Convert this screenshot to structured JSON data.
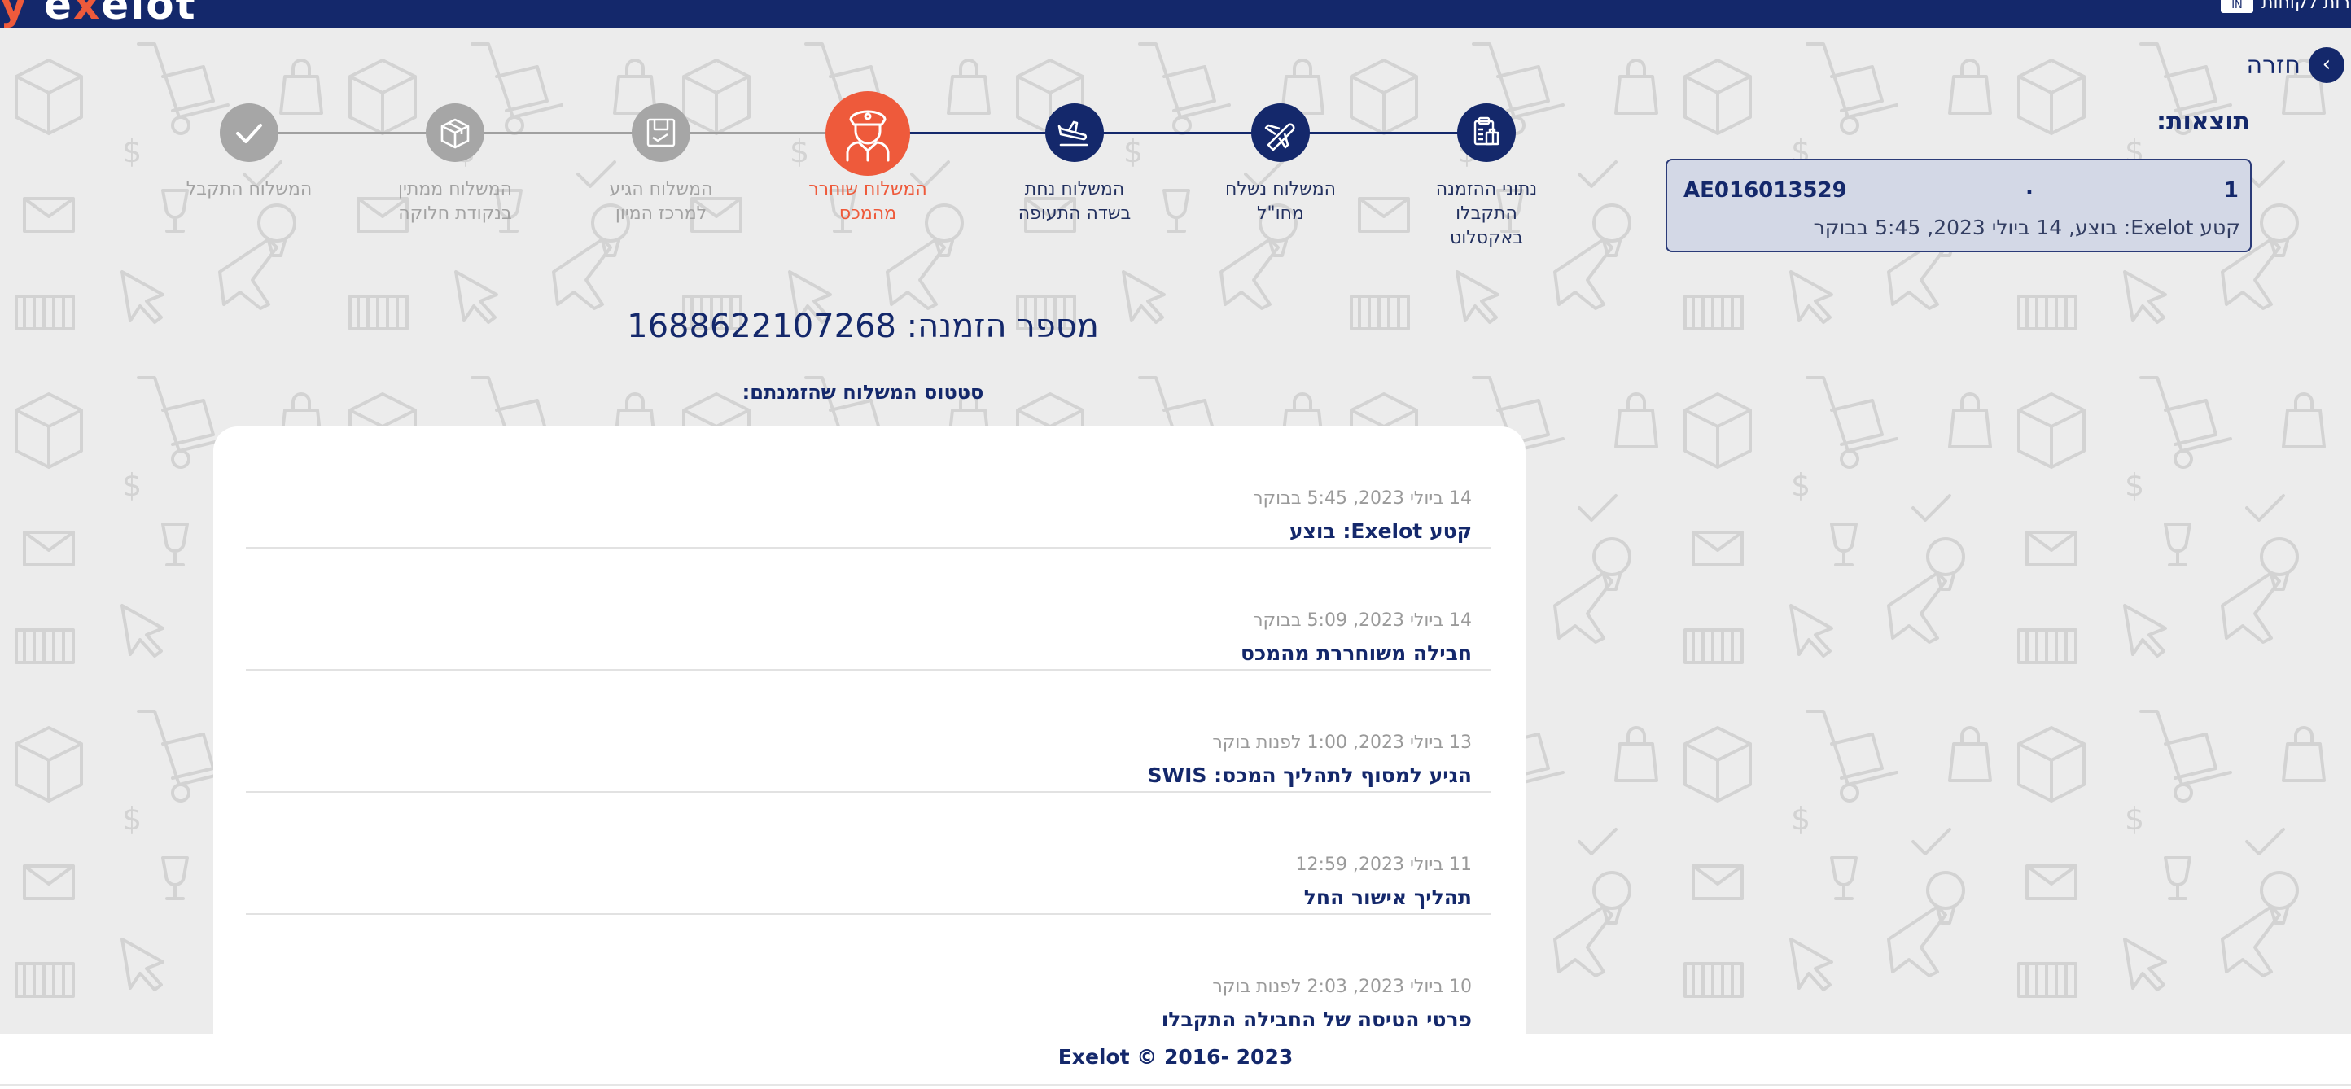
{
  "header": {
    "logo_prefix": "y",
    "logo_main_1": "e",
    "logo_accent": "x",
    "logo_main_2": "elot",
    "lang_code": "IN",
    "top_link": "שירות לקוחות",
    "colors": {
      "navy": "#14286b",
      "accent": "#ee5a3b"
    }
  },
  "back": {
    "label": "חזרה",
    "icon": "chevron-right-icon"
  },
  "results": {
    "title": "תוצאות:",
    "items": [
      {
        "index": "1",
        "separator": ".",
        "tracking_number": "AE016013529",
        "status": "קטע Exelot: בוצע, 14 ביולי 2023, 5:45 בבוקר"
      }
    ]
  },
  "stepper": {
    "steps": [
      {
        "label_line1": "נתוני ההזמנה",
        "label_line2": "התקבלו",
        "label_line3": "באקסלוט",
        "state": "done",
        "icon": "clipboard-icon"
      },
      {
        "label_line1": "המשלוח נשלח",
        "label_line2": "מחו\"ל",
        "label_line3": "",
        "state": "done",
        "icon": "airplane-takeoff-icon"
      },
      {
        "label_line1": "המשלוח נחת",
        "label_line2": "בשדה התעופה",
        "label_line3": "",
        "state": "done",
        "icon": "airplane-landing-icon"
      },
      {
        "label_line1": "המשלוח שוחרר",
        "label_line2": "מהמכס",
        "label_line3": "",
        "state": "current",
        "icon": "customs-officer-icon"
      },
      {
        "label_line1": "המשלוח הגיע",
        "label_line2": "למרכז המיון",
        "label_line3": "",
        "state": "future",
        "icon": "sorting-center-icon"
      },
      {
        "label_line1": "המשלוח ממתין",
        "label_line2": "בנקודת חלוקה",
        "label_line3": "",
        "state": "future",
        "icon": "package-icon"
      },
      {
        "label_line1": "המשלוח התקבל",
        "label_line2": "",
        "label_line3": "",
        "state": "future",
        "icon": "checkmark-icon"
      }
    ]
  },
  "order": {
    "title": "מספר הזמנה: 1688622107268",
    "status_subtitle": "סטטוס המשלוח שהזמנתם:"
  },
  "events": [
    {
      "date": "14 ביולי 2023, 5:45 בבוקר",
      "text": "קטע Exelot: בוצע"
    },
    {
      "date": "14 ביולי 2023, 5:09 בבוקר",
      "text": "חבילה משוחררת מהמכס"
    },
    {
      "date": "13 ביולי 2023, 1:00 לפנות בוקר",
      "text": "הגיע למסוף לתהליך המכס: SWIS"
    },
    {
      "date": "11 ביולי 2023, 12:59",
      "text": "תהליך אישור החל"
    },
    {
      "date": "10 ביולי 2023, 2:03 לפנות בוקר",
      "text": "פרטי הטיסה של החבילה התקבלו"
    }
  ],
  "footer": {
    "text": "Exelot © 2016- 2023"
  }
}
